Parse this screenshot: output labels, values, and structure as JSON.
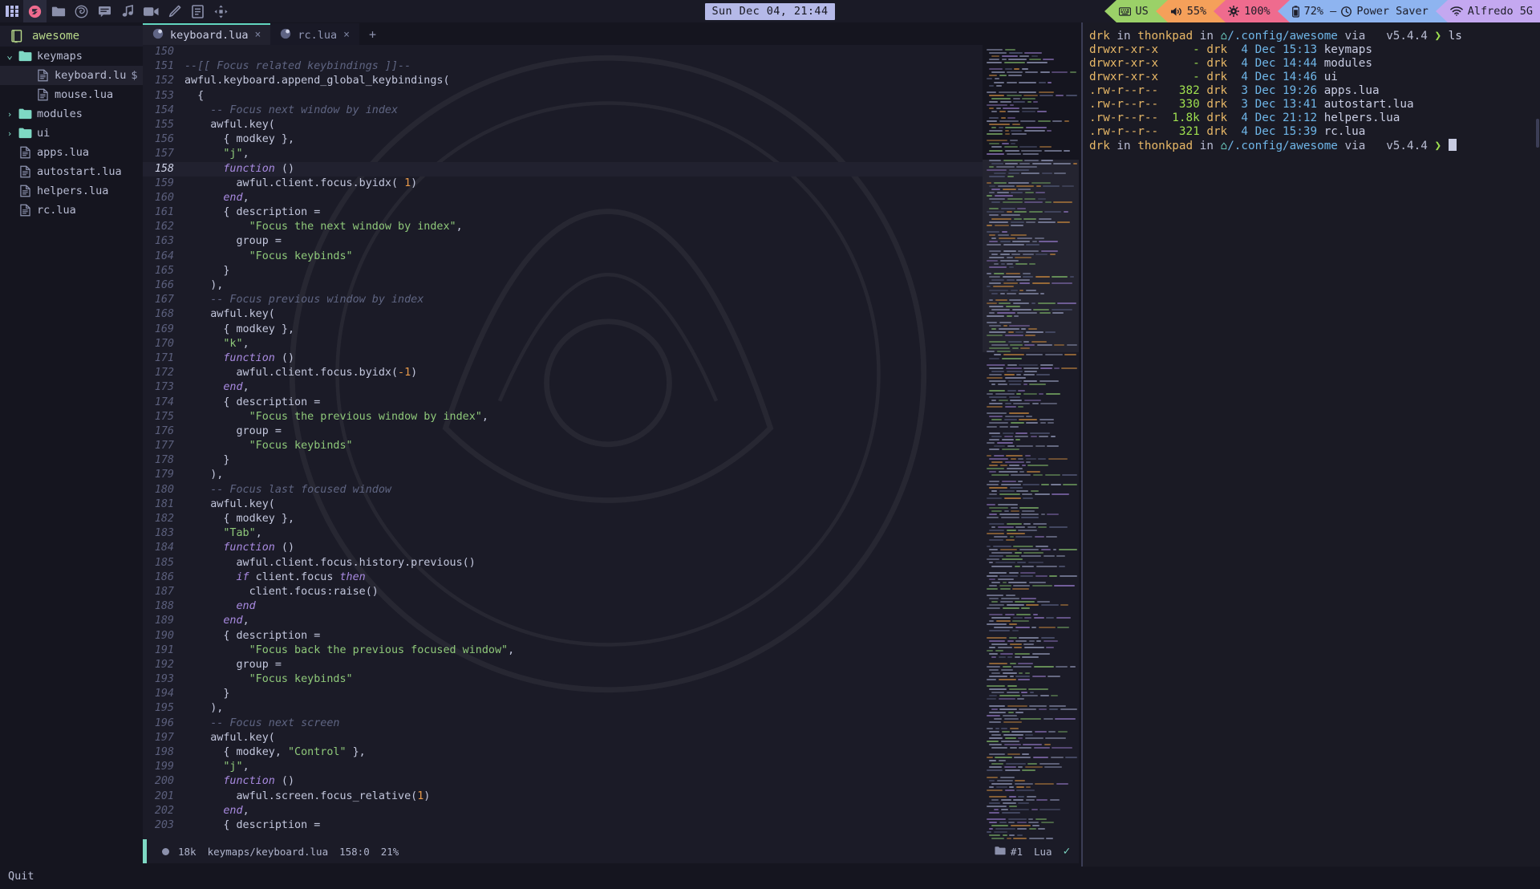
{
  "topbar": {
    "tray_icons": [
      {
        "name": "app-grid-icon",
        "glyph": "grid"
      },
      {
        "name": "emacs-icon",
        "glyph": "emacs"
      },
      {
        "name": "folder-icon",
        "glyph": "folder"
      },
      {
        "name": "firefox-icon",
        "glyph": "firefox"
      },
      {
        "name": "chat-icon",
        "glyph": "chat"
      },
      {
        "name": "music-icon",
        "glyph": "music"
      },
      {
        "name": "video-icon",
        "glyph": "video"
      },
      {
        "name": "pencil-icon",
        "glyph": "pencil"
      },
      {
        "name": "notes-icon",
        "glyph": "notes"
      },
      {
        "name": "layout-icon",
        "glyph": "layout"
      }
    ],
    "clock": "Sun Dec 04, 21:44",
    "segments": [
      {
        "label": "US",
        "icon": "keyboard-icon",
        "bg": "#9bd168",
        "fg": "#1d1d28"
      },
      {
        "label": "55%",
        "icon": "volume-icon",
        "bg": "#f5a05a",
        "fg": "#1d1d28"
      },
      {
        "label": "100%",
        "icon": "brightness-icon",
        "bg": "#ef6b8e",
        "fg": "#1d1d28"
      },
      {
        "label": "72% – Power Saver",
        "icon": "battery-icon",
        "bg": "#8eb4f0",
        "fg": "#1d1d28"
      },
      {
        "label": "Alfredo 5G",
        "icon": "wifi-icon",
        "bg": "#c4a8f0",
        "fg": "#1d1d28"
      }
    ]
  },
  "sidebar": {
    "project": "awesome",
    "project_icon": "book-icon",
    "tree": [
      {
        "label": "keymaps",
        "type": "folder",
        "chevron": "open",
        "indent": 0,
        "selected": false,
        "modified": ""
      },
      {
        "label": "keyboard.lu",
        "type": "file",
        "chevron": "none",
        "indent": 1,
        "selected": true,
        "modified": "$"
      },
      {
        "label": "mouse.lua",
        "type": "file",
        "chevron": "none",
        "indent": 1,
        "selected": false,
        "modified": ""
      },
      {
        "label": "modules",
        "type": "folder",
        "chevron": "closed",
        "indent": 0,
        "selected": false,
        "modified": ""
      },
      {
        "label": "ui",
        "type": "folder",
        "chevron": "closed",
        "indent": 0,
        "selected": false,
        "modified": ""
      },
      {
        "label": "apps.lua",
        "type": "file",
        "chevron": "none",
        "indent": 0,
        "selected": false,
        "modified": ""
      },
      {
        "label": "autostart.lua",
        "type": "file",
        "chevron": "none",
        "indent": 0,
        "selected": false,
        "modified": ""
      },
      {
        "label": "helpers.lua",
        "type": "file",
        "chevron": "none",
        "indent": 0,
        "selected": false,
        "modified": ""
      },
      {
        "label": "rc.lua",
        "type": "file",
        "chevron": "none",
        "indent": 0,
        "selected": false,
        "modified": ""
      }
    ]
  },
  "tabs": {
    "items": [
      {
        "label": "keyboard.lua",
        "active": true,
        "close": "×"
      },
      {
        "label": "rc.lua",
        "active": false,
        "close": "×"
      }
    ],
    "new_tab": "+"
  },
  "code": {
    "first_line_number": 150,
    "current_line": 158,
    "lines": [
      {
        "n": 150,
        "tokens": []
      },
      {
        "n": 151,
        "tokens": [
          {
            "t": "com",
            "s": "--[[ Focus related keybindings ]]--"
          }
        ]
      },
      {
        "n": 152,
        "tokens": [
          {
            "t": "pl",
            "s": "awful.keyboard.append_global_keybindings("
          }
        ]
      },
      {
        "n": 153,
        "tokens": [
          {
            "t": "pl",
            "s": "  {"
          }
        ]
      },
      {
        "n": 154,
        "tokens": [
          {
            "t": "pl",
            "s": "    "
          },
          {
            "t": "com",
            "s": "-- Focus next window by index"
          }
        ]
      },
      {
        "n": 155,
        "tokens": [
          {
            "t": "pl",
            "s": "    awful.key("
          }
        ]
      },
      {
        "n": 156,
        "tokens": [
          {
            "t": "pl",
            "s": "      { modkey },"
          }
        ]
      },
      {
        "n": 157,
        "tokens": [
          {
            "t": "pl",
            "s": "      "
          },
          {
            "t": "str",
            "s": "\"j\""
          },
          {
            "t": "pl",
            "s": ","
          }
        ]
      },
      {
        "n": 158,
        "tokens": [
          {
            "t": "pl",
            "s": "      "
          },
          {
            "t": "kw",
            "s": "function"
          },
          {
            "t": "pl",
            "s": " ()"
          }
        ]
      },
      {
        "n": 159,
        "tokens": [
          {
            "t": "pl",
            "s": "        awful.client.focus.byidx( "
          },
          {
            "t": "num",
            "s": "1"
          },
          {
            "t": "pl",
            "s": ")"
          }
        ]
      },
      {
        "n": 160,
        "tokens": [
          {
            "t": "pl",
            "s": "      "
          },
          {
            "t": "kw",
            "s": "end"
          },
          {
            "t": "pl",
            "s": ","
          }
        ]
      },
      {
        "n": 161,
        "tokens": [
          {
            "t": "pl",
            "s": "      { description ="
          }
        ]
      },
      {
        "n": 162,
        "tokens": [
          {
            "t": "pl",
            "s": "          "
          },
          {
            "t": "str",
            "s": "\"Focus the next window by index\""
          },
          {
            "t": "pl",
            "s": ","
          }
        ]
      },
      {
        "n": 163,
        "tokens": [
          {
            "t": "pl",
            "s": "        group ="
          }
        ]
      },
      {
        "n": 164,
        "tokens": [
          {
            "t": "pl",
            "s": "          "
          },
          {
            "t": "str",
            "s": "\"Focus keybinds\""
          }
        ]
      },
      {
        "n": 165,
        "tokens": [
          {
            "t": "pl",
            "s": "      }"
          }
        ]
      },
      {
        "n": 166,
        "tokens": [
          {
            "t": "pl",
            "s": "    ),"
          }
        ]
      },
      {
        "n": 167,
        "tokens": [
          {
            "t": "pl",
            "s": "    "
          },
          {
            "t": "com",
            "s": "-- Focus previous window by index"
          }
        ]
      },
      {
        "n": 168,
        "tokens": [
          {
            "t": "pl",
            "s": "    awful.key("
          }
        ]
      },
      {
        "n": 169,
        "tokens": [
          {
            "t": "pl",
            "s": "      { modkey },"
          }
        ]
      },
      {
        "n": 170,
        "tokens": [
          {
            "t": "pl",
            "s": "      "
          },
          {
            "t": "str",
            "s": "\"k\""
          },
          {
            "t": "pl",
            "s": ","
          }
        ]
      },
      {
        "n": 171,
        "tokens": [
          {
            "t": "pl",
            "s": "      "
          },
          {
            "t": "kw",
            "s": "function"
          },
          {
            "t": "pl",
            "s": " ()"
          }
        ]
      },
      {
        "n": 172,
        "tokens": [
          {
            "t": "pl",
            "s": "        awful.client.focus.byidx("
          },
          {
            "t": "num",
            "s": "-1"
          },
          {
            "t": "pl",
            "s": ")"
          }
        ]
      },
      {
        "n": 173,
        "tokens": [
          {
            "t": "pl",
            "s": "      "
          },
          {
            "t": "kw",
            "s": "end"
          },
          {
            "t": "pl",
            "s": ","
          }
        ]
      },
      {
        "n": 174,
        "tokens": [
          {
            "t": "pl",
            "s": "      { description ="
          }
        ]
      },
      {
        "n": 175,
        "tokens": [
          {
            "t": "pl",
            "s": "          "
          },
          {
            "t": "str",
            "s": "\"Focus the previous window by index\""
          },
          {
            "t": "pl",
            "s": ","
          }
        ]
      },
      {
        "n": 176,
        "tokens": [
          {
            "t": "pl",
            "s": "        group ="
          }
        ]
      },
      {
        "n": 177,
        "tokens": [
          {
            "t": "pl",
            "s": "          "
          },
          {
            "t": "str",
            "s": "\"Focus keybinds\""
          }
        ]
      },
      {
        "n": 178,
        "tokens": [
          {
            "t": "pl",
            "s": "      }"
          }
        ]
      },
      {
        "n": 179,
        "tokens": [
          {
            "t": "pl",
            "s": "    ),"
          }
        ]
      },
      {
        "n": 180,
        "tokens": [
          {
            "t": "pl",
            "s": "    "
          },
          {
            "t": "com",
            "s": "-- Focus last focused window"
          }
        ]
      },
      {
        "n": 181,
        "tokens": [
          {
            "t": "pl",
            "s": "    awful.key("
          }
        ]
      },
      {
        "n": 182,
        "tokens": [
          {
            "t": "pl",
            "s": "      { modkey },"
          }
        ]
      },
      {
        "n": 183,
        "tokens": [
          {
            "t": "pl",
            "s": "      "
          },
          {
            "t": "str",
            "s": "\"Tab\""
          },
          {
            "t": "pl",
            "s": ","
          }
        ]
      },
      {
        "n": 184,
        "tokens": [
          {
            "t": "pl",
            "s": "      "
          },
          {
            "t": "kw",
            "s": "function"
          },
          {
            "t": "pl",
            "s": " ()"
          }
        ]
      },
      {
        "n": 185,
        "tokens": [
          {
            "t": "pl",
            "s": "        awful.client.focus.history.previous()"
          }
        ]
      },
      {
        "n": 186,
        "tokens": [
          {
            "t": "pl",
            "s": "        "
          },
          {
            "t": "kw",
            "s": "if"
          },
          {
            "t": "pl",
            "s": " client.focus "
          },
          {
            "t": "kw",
            "s": "then"
          }
        ]
      },
      {
        "n": 187,
        "tokens": [
          {
            "t": "pl",
            "s": "          client.focus:raise()"
          }
        ]
      },
      {
        "n": 188,
        "tokens": [
          {
            "t": "pl",
            "s": "        "
          },
          {
            "t": "kw",
            "s": "end"
          }
        ]
      },
      {
        "n": 189,
        "tokens": [
          {
            "t": "pl",
            "s": "      "
          },
          {
            "t": "kw",
            "s": "end"
          },
          {
            "t": "pl",
            "s": ","
          }
        ]
      },
      {
        "n": 190,
        "tokens": [
          {
            "t": "pl",
            "s": "      { description ="
          }
        ]
      },
      {
        "n": 191,
        "tokens": [
          {
            "t": "pl",
            "s": "          "
          },
          {
            "t": "str",
            "s": "\"Focus back the previous focused window\""
          },
          {
            "t": "pl",
            "s": ","
          }
        ]
      },
      {
        "n": 192,
        "tokens": [
          {
            "t": "pl",
            "s": "        group ="
          }
        ]
      },
      {
        "n": 193,
        "tokens": [
          {
            "t": "pl",
            "s": "          "
          },
          {
            "t": "str",
            "s": "\"Focus keybinds\""
          }
        ]
      },
      {
        "n": 194,
        "tokens": [
          {
            "t": "pl",
            "s": "      }"
          }
        ]
      },
      {
        "n": 195,
        "tokens": [
          {
            "t": "pl",
            "s": "    ),"
          }
        ]
      },
      {
        "n": 196,
        "tokens": [
          {
            "t": "pl",
            "s": "    "
          },
          {
            "t": "com",
            "s": "-- Focus next screen"
          }
        ]
      },
      {
        "n": 197,
        "tokens": [
          {
            "t": "pl",
            "s": "    awful.key("
          }
        ]
      },
      {
        "n": 198,
        "tokens": [
          {
            "t": "pl",
            "s": "      { modkey, "
          },
          {
            "t": "str",
            "s": "\"Control\""
          },
          {
            "t": "pl",
            "s": " },"
          }
        ]
      },
      {
        "n": 199,
        "tokens": [
          {
            "t": "pl",
            "s": "      "
          },
          {
            "t": "str",
            "s": "\"j\""
          },
          {
            "t": "pl",
            "s": ","
          }
        ]
      },
      {
        "n": 200,
        "tokens": [
          {
            "t": "pl",
            "s": "      "
          },
          {
            "t": "kw",
            "s": "function"
          },
          {
            "t": "pl",
            "s": " ()"
          }
        ]
      },
      {
        "n": 201,
        "tokens": [
          {
            "t": "pl",
            "s": "        awful.screen.focus_relative("
          },
          {
            "t": "num",
            "s": "1"
          },
          {
            "t": "pl",
            "s": ")"
          }
        ]
      },
      {
        "n": 202,
        "tokens": [
          {
            "t": "pl",
            "s": "      "
          },
          {
            "t": "kw",
            "s": "end"
          },
          {
            "t": "pl",
            "s": ","
          }
        ]
      },
      {
        "n": 203,
        "tokens": [
          {
            "t": "pl",
            "s": "      { description ="
          }
        ]
      }
    ]
  },
  "statusbar": {
    "modified_indicator": "●",
    "file_size": "18k",
    "file_path": "keymaps/keyboard.lua",
    "cursor_position": "158:0",
    "scroll_percent": "21%",
    "buffer_icon": "folder-icon",
    "buffer_label": "#1",
    "language": "Lua",
    "check_glyph": "✓"
  },
  "command_line": {
    "text": "Quit"
  },
  "terminal": {
    "scrollbar_visible": true,
    "lines": [
      {
        "type": "prompt",
        "parts": [
          {
            "c": "user",
            "s": "drk"
          },
          {
            "c": "plain",
            "s": " in "
          },
          {
            "c": "user",
            "s": "thonkpad"
          },
          {
            "c": "plain",
            "s": " in "
          },
          {
            "c": "home",
            "s": ""
          },
          {
            "c": "dir",
            "s": "/.config/awesome"
          },
          {
            "c": "plain",
            "s": " via "
          },
          {
            "c": "plain",
            "s": "  "
          },
          {
            "c": "ver",
            "s": "v5.4.4"
          },
          {
            "c": "arrow",
            "s": " ❯ "
          },
          {
            "c": "cmd",
            "s": "ls"
          }
        ]
      },
      {
        "type": "entry",
        "perm": "drwxr-xr-x",
        "size": "-",
        "owner": "drk",
        "links": "4",
        "month": "Dec",
        "time": "15:13",
        "name": "keymaps"
      },
      {
        "type": "entry",
        "perm": "drwxr-xr-x",
        "size": "-",
        "owner": "drk",
        "links": "4",
        "month": "Dec",
        "time": "14:44",
        "name": "modules"
      },
      {
        "type": "entry",
        "perm": "drwxr-xr-x",
        "size": "-",
        "owner": "drk",
        "links": "4",
        "month": "Dec",
        "time": "14:46",
        "name": "ui"
      },
      {
        "type": "entry",
        "perm": ".rw-r--r--",
        "size": "382",
        "owner": "drk",
        "links": "3",
        "month": "Dec",
        "time": "19:26",
        "name": "apps.lua"
      },
      {
        "type": "entry",
        "perm": ".rw-r--r--",
        "size": "330",
        "owner": "drk",
        "links": "3",
        "month": "Dec",
        "time": "13:41",
        "name": "autostart.lua"
      },
      {
        "type": "entry",
        "perm": ".rw-r--r--",
        "size": "1.8k",
        "owner": "drk",
        "links": "4",
        "month": "Dec",
        "time": "21:12",
        "name": "helpers.lua"
      },
      {
        "type": "entry",
        "perm": ".rw-r--r--",
        "size": "321",
        "owner": "drk",
        "links": "4",
        "month": "Dec",
        "time": "15:39",
        "name": "rc.lua"
      },
      {
        "type": "prompt",
        "parts": [
          {
            "c": "user",
            "s": "drk"
          },
          {
            "c": "plain",
            "s": " in "
          },
          {
            "c": "user",
            "s": "thonkpad"
          },
          {
            "c": "plain",
            "s": " in "
          },
          {
            "c": "home",
            "s": ""
          },
          {
            "c": "dir",
            "s": "/.config/awesome"
          },
          {
            "c": "plain",
            "s": " via "
          },
          {
            "c": "plain",
            "s": "  "
          },
          {
            "c": "ver",
            "s": "v5.4.4"
          },
          {
            "c": "arrow",
            "s": " ❯ "
          }
        ],
        "cursor": true
      }
    ]
  },
  "colors": {
    "bg": "#15151f",
    "editor_bg": "#1b1b27",
    "terminal_bg": "#1a1a24",
    "accent": "#7ed9c4",
    "topbar_bg": "#1a1a26",
    "string": "#8fc97a",
    "keyword": "#a88ae0",
    "comment": "#5f6582",
    "number": "#e89a4a"
  }
}
